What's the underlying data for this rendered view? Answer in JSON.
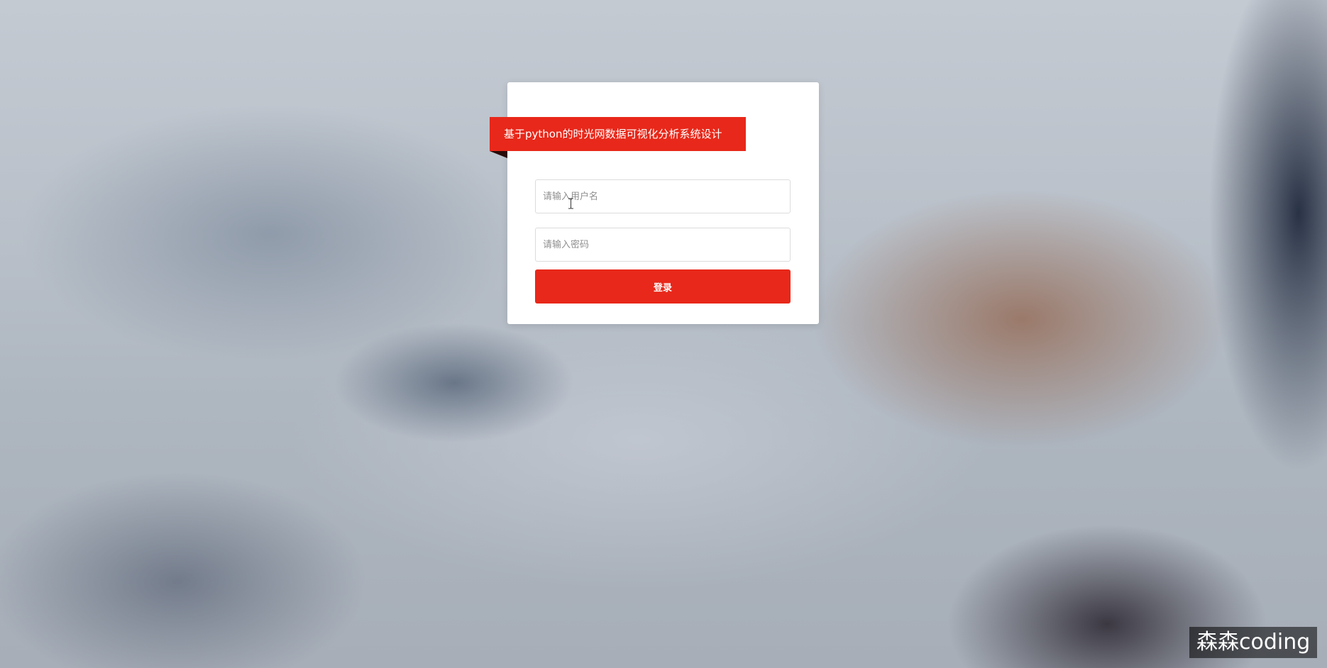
{
  "login": {
    "title": "基于python的时光网数据可视化分析系统设计",
    "username_placeholder": "请输入用户名",
    "password_placeholder": "请输入密码",
    "login_label": "登录"
  },
  "watermark": {
    "text": "森森coding"
  },
  "colors": {
    "accent": "#e8281a",
    "card": "#ffffff"
  },
  "icons": {
    "cursor": "text-cursor-icon"
  }
}
